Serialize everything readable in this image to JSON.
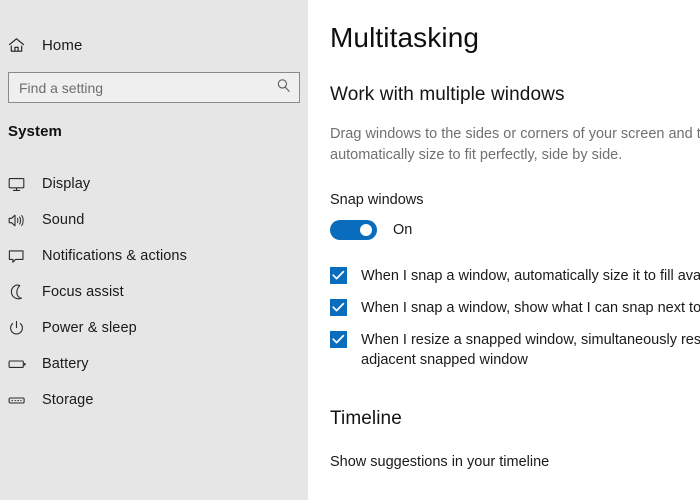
{
  "sidebar": {
    "home": {
      "label": "Home",
      "icon": "home-icon"
    },
    "search": {
      "value": "",
      "placeholder": "Find a setting",
      "icon": "search-icon"
    },
    "section_title": "System",
    "items": [
      {
        "label": "Display",
        "icon": "monitor-icon"
      },
      {
        "label": "Sound",
        "icon": "speaker-icon"
      },
      {
        "label": "Notifications & actions",
        "icon": "notification-balloon-icon"
      },
      {
        "label": "Focus assist",
        "icon": "moon-icon"
      },
      {
        "label": "Power & sleep",
        "icon": "power-icon"
      },
      {
        "label": "Battery",
        "icon": "battery-icon"
      },
      {
        "label": "Storage",
        "icon": "storage-drive-icon"
      }
    ]
  },
  "main": {
    "page_title": "Multitasking",
    "section_heading": "Work with multiple windows",
    "description": "Drag windows to the sides or corners of your screen and they'll automatically size to fit perfectly, side by side.",
    "snap": {
      "label": "Snap windows",
      "toggle_state": "On",
      "toggle_on": true,
      "options": [
        {
          "label": "When I snap a window, automatically size it to fill available space",
          "checked": true
        },
        {
          "label": "When I snap a window, show what I can snap next to it",
          "checked": true
        },
        {
          "label": "When I resize a snapped window, simultaneously resize any adjacent snapped window",
          "checked": true
        }
      ]
    },
    "timeline": {
      "heading": "Timeline",
      "subtext": "Show suggestions in your timeline"
    }
  },
  "colors": {
    "accent": "#0a6cbd",
    "sidebar_bg": "#e6e6e6",
    "main_bg": "#ffffff",
    "text": "#1a1a1a",
    "muted_text": "#707070"
  }
}
